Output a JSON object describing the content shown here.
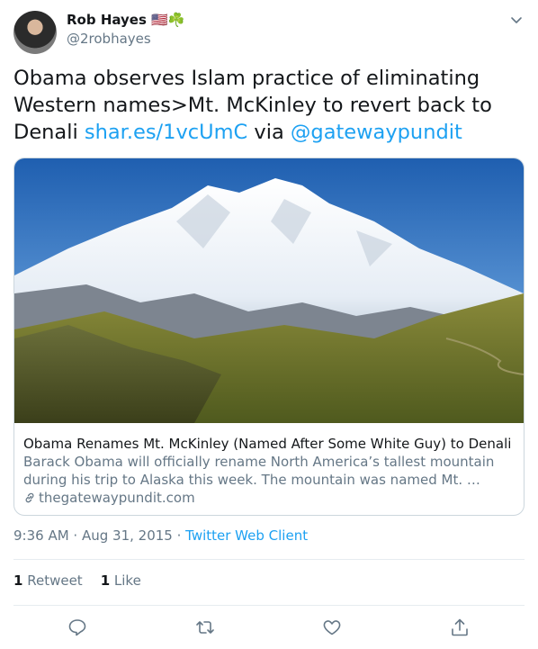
{
  "author": {
    "name": "Rob Hayes",
    "flag_emoji": "🇺🇸",
    "shamrock_emoji": "☘️",
    "handle": "@2robhayes"
  },
  "tweet": {
    "text_before": "Obama observes Islam practice of eliminating Western names>Mt. McKinley to revert back to Denali ",
    "link_text": "shar.es/1vcUmC",
    "via_text": " via ",
    "mention_text": "@gatewaypundit"
  },
  "card": {
    "title": "Obama Renames Mt. McKinley (Named After Some White Guy) to Denali",
    "description": "Barack Obama will officially rename North America’s tallest mountain during his trip to Alaska this week. The mountain was named Mt. …",
    "domain": "thegatewaypundit.com"
  },
  "meta": {
    "time": "9:36 AM",
    "separator1": " · ",
    "date": "Aug 31, 2015",
    "separator2": " · ",
    "client": "Twitter Web Client"
  },
  "stats": {
    "retweet_count": "1",
    "retweet_label": "Retweet",
    "like_count": "1",
    "like_label": "Like"
  },
  "icons": {
    "caret": "chevron-down-icon",
    "link": "link-icon",
    "reply": "reply-icon",
    "retweet": "retweet-icon",
    "like": "heart-icon",
    "share": "share-icon"
  },
  "colors": {
    "text": "#14171a",
    "secondary": "#657786",
    "link": "#1da1f2",
    "border": "#ccd6dd",
    "divider": "#e6ecf0"
  }
}
